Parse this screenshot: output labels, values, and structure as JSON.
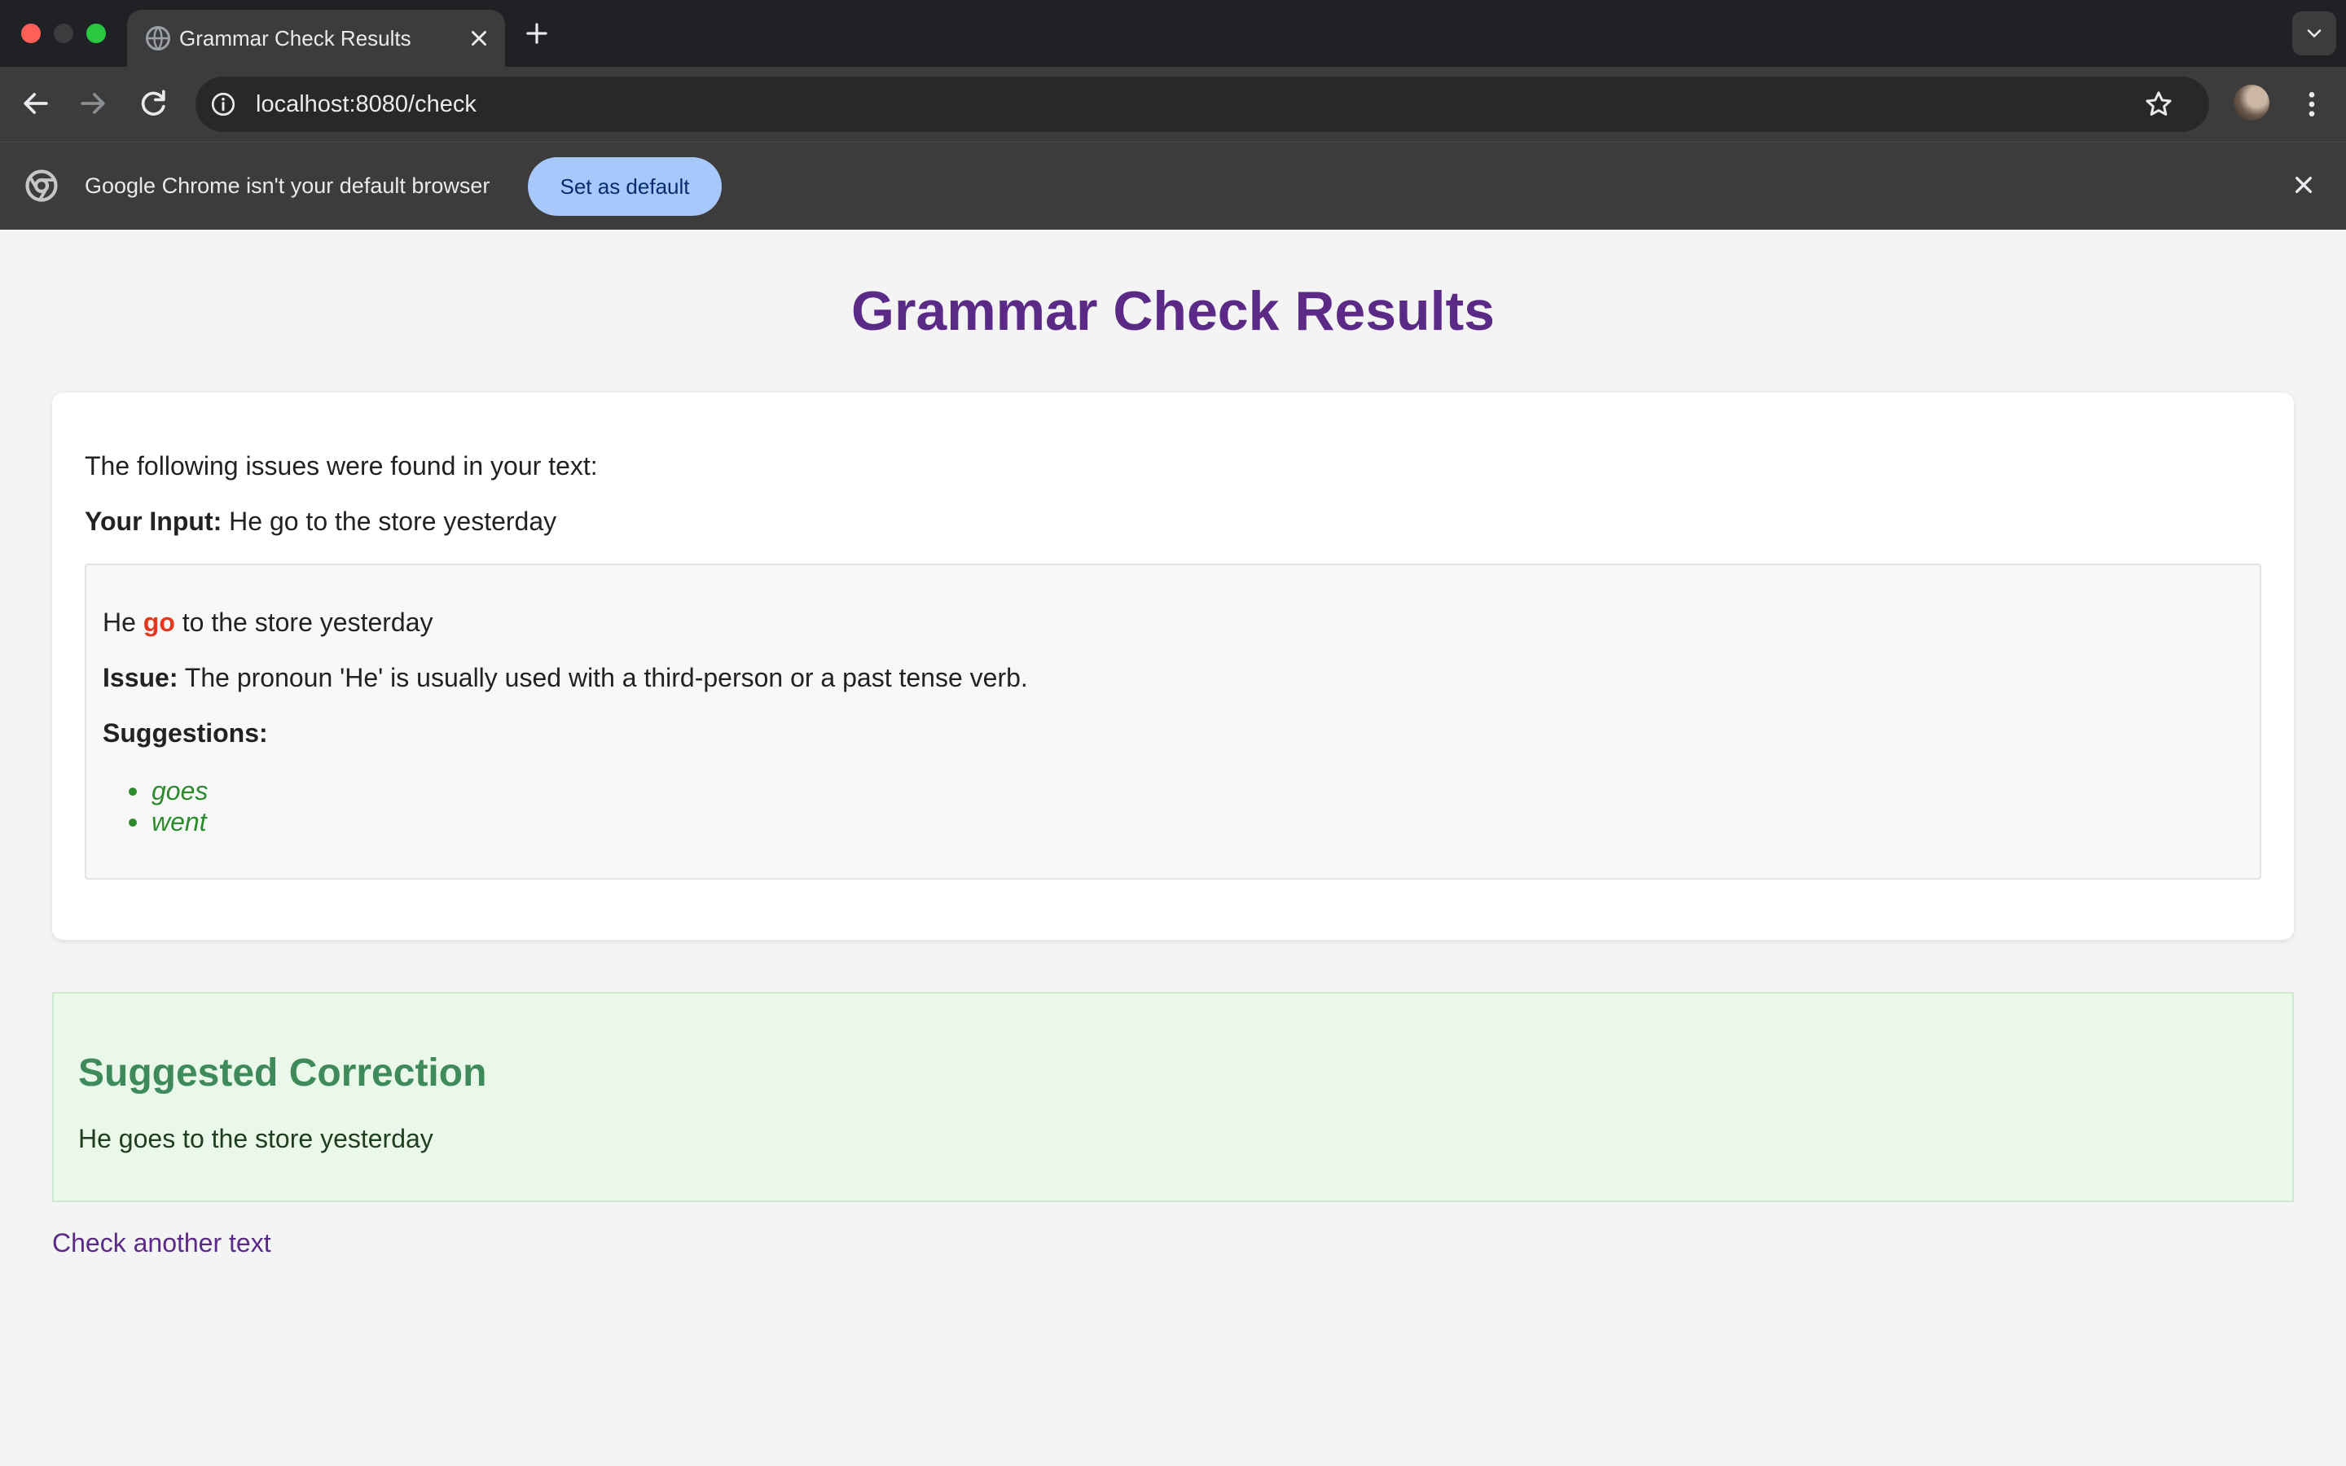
{
  "browser": {
    "tab_title": "Grammar Check Results",
    "url": "localhost:8080/check",
    "infobar_text": "Google Chrome isn't your default browser",
    "set_default_label": "Set as default",
    "icons": {
      "favicon": "globe-icon",
      "tab_close": "close-icon",
      "new_tab": "plus-icon",
      "tab_search": "chevron-down-icon",
      "back": "arrow-left-icon",
      "forward": "arrow-right-icon",
      "reload": "reload-icon",
      "site_info": "info-icon",
      "bookmark": "star-icon",
      "menu": "more-vert-icon",
      "infobar_logo": "chrome-logo-icon",
      "infobar_close": "close-icon"
    },
    "colors": {
      "tab_strip": "#202124",
      "toolbar": "#3c3c3c",
      "set_default_bg": "#a8c7fa"
    }
  },
  "page": {
    "title": "Grammar Check Results",
    "intro": "The following issues were found in your text:",
    "input_label": "Your Input:",
    "input_text": "He go to the store yesterday",
    "issue": {
      "before": "He",
      "error_word": "go",
      "after": "to the store yesterday",
      "issue_label": "Issue:",
      "issue_text": "The pronoun 'He' is usually used with a third-person or a past tense verb.",
      "suggestions_label": "Suggestions:",
      "suggestions": [
        "goes",
        "went"
      ]
    },
    "correction": {
      "title": "Suggested Correction",
      "text": "He goes to the store yesterday"
    },
    "link_label": "Check another text",
    "colors": {
      "title": "#5b2a86",
      "error": "#e03a1e",
      "suggestion": "#2d8a2d",
      "correction_title": "#3e8a5a",
      "correction_bg": "#eaf8ea"
    }
  }
}
